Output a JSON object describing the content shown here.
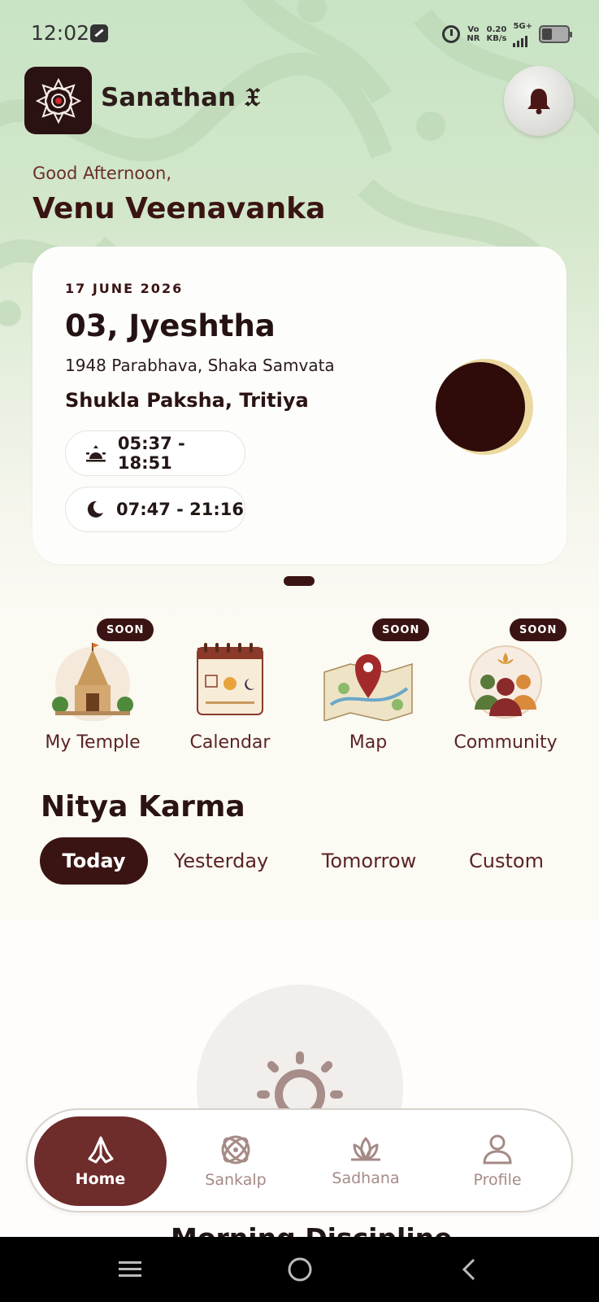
{
  "status_bar": {
    "time": "12:02",
    "network_top": "Vo",
    "network_bottom": "NR",
    "speed_value": "0.20",
    "speed_unit": "KB/s",
    "signal_label": "5G+"
  },
  "header": {
    "app_name": "Sanathan 𝔛",
    "logo_icon": "mandala-logo-icon",
    "notification_icon": "bell-icon"
  },
  "greeting": {
    "salutation": "Good Afternoon,",
    "user_name": "Venu Veenavanka"
  },
  "panchang": {
    "date": "17 JUNE 2026",
    "tithi_date": "03, Jyeshtha",
    "samvat": "1948 Parabhava, Shaka Samvata",
    "paksha": "Shukla Paksha, Tritiya",
    "sun_times": "05:37 - 18:51",
    "moon_times": "07:47 - 21:16",
    "moon_phase": "waxing-crescent"
  },
  "quick_actions": [
    {
      "label": "My Temple",
      "badge": "SOON",
      "icon": "temple-icon"
    },
    {
      "label": "Calendar",
      "badge": "",
      "icon": "calendar-icon"
    },
    {
      "label": "Map",
      "badge": "SOON",
      "icon": "map-icon"
    },
    {
      "label": "Community",
      "badge": "SOON",
      "icon": "community-icon"
    }
  ],
  "nitya_karma": {
    "title": "Nitya Karma",
    "tabs": [
      "Today",
      "Yesterday",
      "Tomorrow",
      "Custom"
    ],
    "active_tab": "Today",
    "section_heading": "Morning Discipline"
  },
  "bottom_nav": {
    "items": [
      {
        "label": "Home",
        "icon": "namaste-hands-icon",
        "active": true
      },
      {
        "label": "Sankalp",
        "icon": "atom-icon",
        "active": false
      },
      {
        "label": "Sadhana",
        "icon": "lotus-icon",
        "active": false
      },
      {
        "label": "Profile",
        "icon": "person-icon",
        "active": false
      }
    ]
  },
  "colors": {
    "primary": "#3a1413",
    "accent": "#6e2c2b",
    "background_top": "#c8e3c4",
    "muted_text": "#a58a86"
  }
}
